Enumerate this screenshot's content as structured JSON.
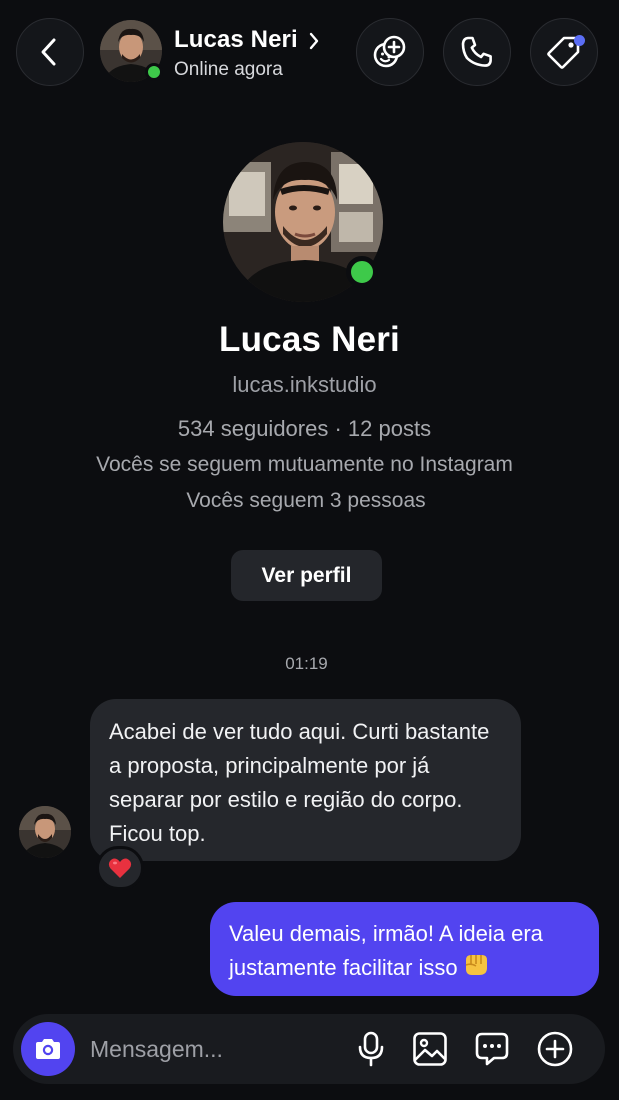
{
  "header": {
    "name": "Lucas Neri",
    "status": "Online agora"
  },
  "profile": {
    "name": "Lucas Neri",
    "username": "lucas.inkstudio",
    "stats": "534 seguidores · 12 posts",
    "mutual": "Vocês se seguem mutuamente no Instagram",
    "following": "Vocês seguem 3 pessoas",
    "view_profile_label": "Ver perfil"
  },
  "conversation": {
    "timestamp": "01:19",
    "messages": [
      {
        "direction": "incoming",
        "text": "Acabei de ver tudo aqui. Curti bastante a proposta, principalmente por já separar por estilo e região do corpo. Ficou top.",
        "reaction": "❤️"
      },
      {
        "direction": "outgoing",
        "text": "Valeu demais, irmão! A ideia era justamente facilitar isso",
        "emoji": "👊"
      }
    ]
  },
  "composer": {
    "placeholder": "Mensagem..."
  },
  "colors": {
    "background": "#0c0d10",
    "accent": "#5244f0",
    "online": "#3ec94a",
    "incoming_bubble": "#25272c",
    "notification_dot": "#5b6ef5"
  },
  "icons": [
    "back-arrow-icon",
    "chevron-right-icon",
    "effects-icon",
    "phone-icon",
    "tag-icon",
    "heart-icon",
    "fist-icon",
    "camera-icon",
    "microphone-icon",
    "gallery-icon",
    "sticker-icon",
    "plus-circle-icon"
  ]
}
